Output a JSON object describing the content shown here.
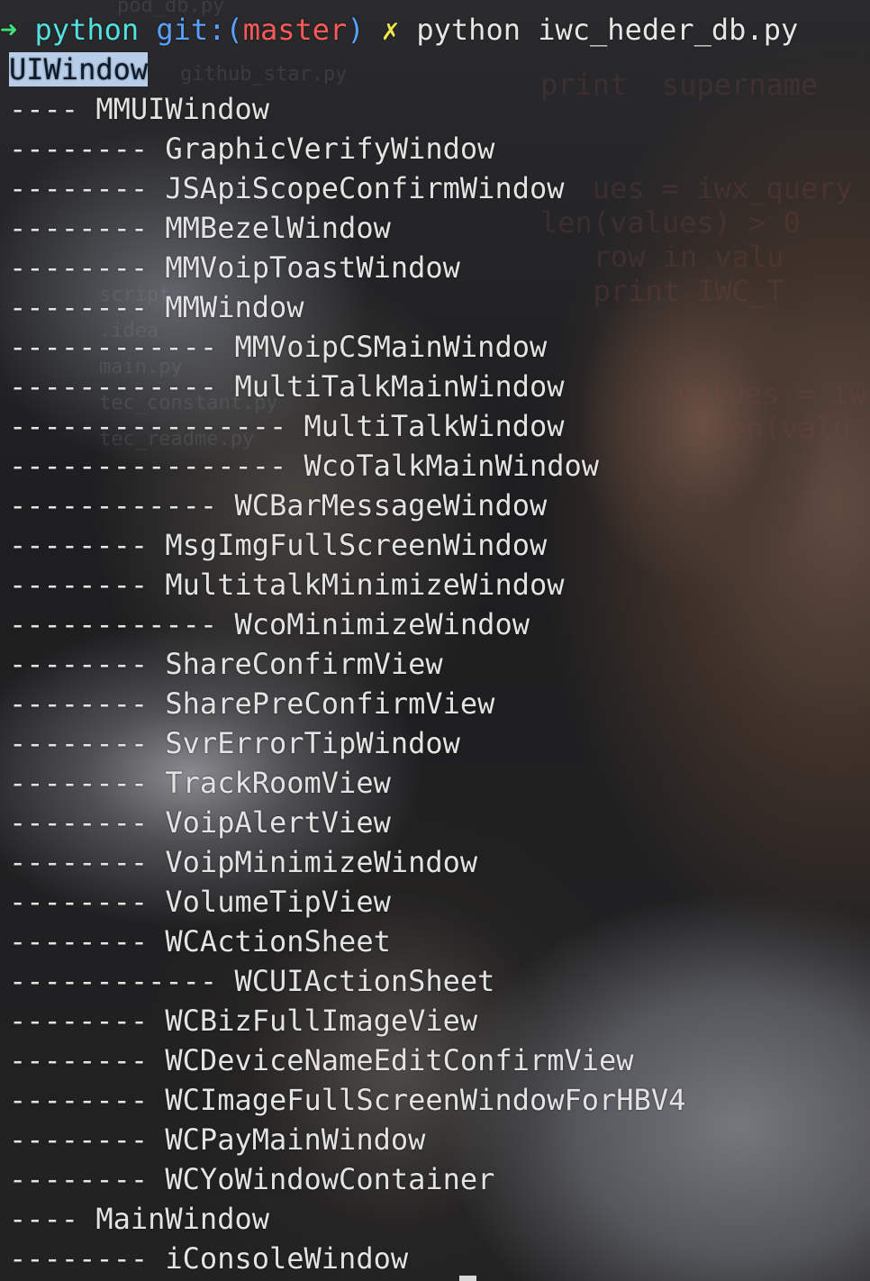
{
  "prompt": {
    "arrow": "➜",
    "dir": "python",
    "git_label": "git:(",
    "branch": "master",
    "git_close": ")",
    "dirty_mark": "✗",
    "command": "python iwc_heder_db.py"
  },
  "output": [
    {
      "dashes": "",
      "name": "UIWindow"
    },
    {
      "dashes": "---- ",
      "name": "MMUIWindow"
    },
    {
      "dashes": "-------- ",
      "name": "GraphicVerifyWindow"
    },
    {
      "dashes": "-------- ",
      "name": "JSApiScopeConfirmWindow"
    },
    {
      "dashes": "-------- ",
      "name": "MMBezelWindow"
    },
    {
      "dashes": "-------- ",
      "name": "MMVoipToastWindow"
    },
    {
      "dashes": "-------- ",
      "name": "MMWindow"
    },
    {
      "dashes": "------------ ",
      "name": "MMVoipCSMainWindow"
    },
    {
      "dashes": "------------ ",
      "name": "MultiTalkMainWindow"
    },
    {
      "dashes": "---------------- ",
      "name": "MultiTalkWindow"
    },
    {
      "dashes": "---------------- ",
      "name": "WcoTalkMainWindow"
    },
    {
      "dashes": "------------ ",
      "name": "WCBarMessageWindow"
    },
    {
      "dashes": "-------- ",
      "name": "MsgImgFullScreenWindow"
    },
    {
      "dashes": "-------- ",
      "name": "MultitalkMinimizeWindow"
    },
    {
      "dashes": "------------ ",
      "name": "WcoMinimizeWindow"
    },
    {
      "dashes": "-------- ",
      "name": "ShareConfirmView"
    },
    {
      "dashes": "-------- ",
      "name": "SharePreConfirmView"
    },
    {
      "dashes": "-------- ",
      "name": "SvrErrorTipWindow"
    },
    {
      "dashes": "-------- ",
      "name": "TrackRoomView"
    },
    {
      "dashes": "-------- ",
      "name": "VoipAlertView"
    },
    {
      "dashes": "-------- ",
      "name": "VoipMinimizeWindow"
    },
    {
      "dashes": "-------- ",
      "name": "VolumeTipView"
    },
    {
      "dashes": "-------- ",
      "name": "WCActionSheet"
    },
    {
      "dashes": "------------ ",
      "name": "WCUIActionSheet"
    },
    {
      "dashes": "-------- ",
      "name": "WCBizFullImageView"
    },
    {
      "dashes": "-------- ",
      "name": "WCDeviceNameEditConfirmView"
    },
    {
      "dashes": "-------- ",
      "name": "WCImageFullScreenWindowForHBV4"
    },
    {
      "dashes": "-------- ",
      "name": "WCPayMainWindow"
    },
    {
      "dashes": "-------- ",
      "name": "WCYoWindowContainer"
    },
    {
      "dashes": "---- ",
      "name": "MainWindow"
    },
    {
      "dashes": "-------- ",
      "name": "iConsoleWindow"
    }
  ],
  "colors": {
    "arrow": "#3fe07a",
    "directory": "#53e0e0",
    "git": "#5aa0ff",
    "branch": "#ff5a5a",
    "dirty_mark": "#f0e64a",
    "text": "#e3e3e3",
    "selection": "#b7cde8"
  }
}
